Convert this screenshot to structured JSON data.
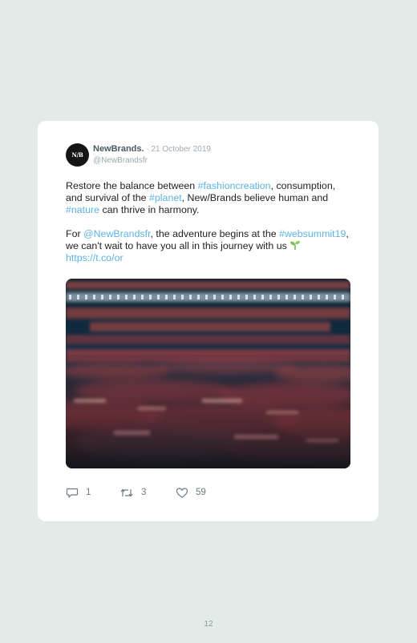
{
  "tweet": {
    "avatar_text": "N/B",
    "author": "NewBrands.",
    "date": " · 21 October 2019",
    "handle": "@NewBrandsfr",
    "body": {
      "p1_a": "Restore the balance between ",
      "p1_tag1": "#fashioncreation",
      "p1_b": ", consumption, and survival of the ",
      "p1_tag2": "#planet",
      "p1_c": ", New/Brands believe human and ",
      "p1_tag3": "#nature",
      "p1_d": " can thrive in harmony.",
      "p2_a": "For ",
      "p2_mention": "@NewBrandsfr",
      "p2_b": ", the adventure begins at the ",
      "p2_tag": "#websummit19",
      "p2_c": ", we can't wait to have you all in this journey with us ",
      "p2_link": "https://t.co/or"
    },
    "stats": {
      "replies": "1",
      "retweets": "3",
      "likes": "59"
    }
  },
  "colors": {
    "background": "#e3ebe8",
    "card": "#ffffff",
    "hashtag": "#5db2e3",
    "muted": "#6e7b82"
  },
  "icons": {
    "emoji": "sprout-icon",
    "reply": "reply-icon",
    "retweet": "retweet-icon",
    "like": "heart-icon"
  },
  "page": {
    "number": "12"
  }
}
